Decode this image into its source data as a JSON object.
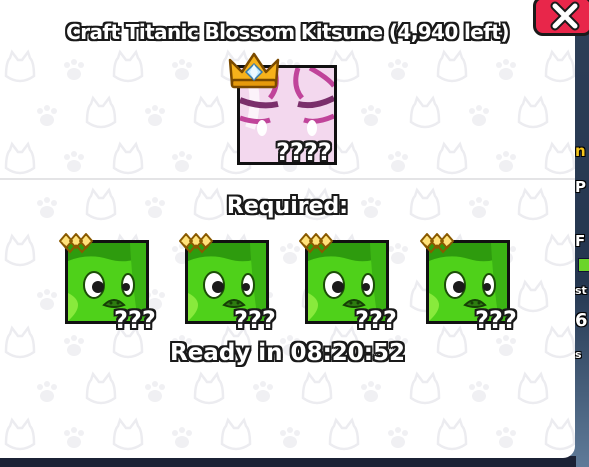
{
  "craft": {
    "title": "Craft Titanic Blossom Kitsune (4,940 left)",
    "result_hidden_label": "????",
    "required_heading": "Required:",
    "required_items": [
      {
        "icon": "green-pet-icon",
        "hidden_label": "???"
      },
      {
        "icon": "green-pet-icon",
        "hidden_label": "???"
      },
      {
        "icon": "green-pet-icon",
        "hidden_label": "???"
      },
      {
        "icon": "green-pet-icon",
        "hidden_label": "???"
      }
    ],
    "ready_text": "Ready in 08:20:52"
  },
  "colors": {
    "close_button": "#e8264a",
    "pet_green": "#4fd11a",
    "result_pink": "#f2d4ec"
  },
  "background": {
    "right_fragments": [
      "n",
      "P",
      "F",
      "st",
      "6",
      "s"
    ]
  }
}
